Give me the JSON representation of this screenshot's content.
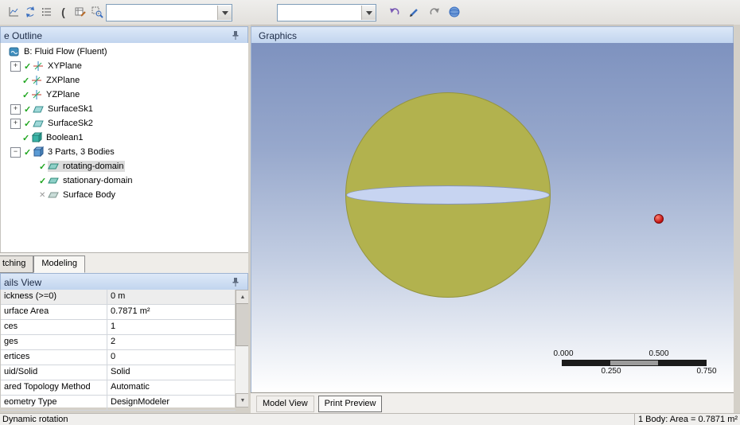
{
  "toolbar": {
    "combo1": {
      "value": ""
    },
    "combo2": {
      "value": ""
    }
  },
  "outline": {
    "title": "e Outline",
    "items": [
      {
        "label": "B: Fluid Flow (Fluent)"
      },
      {
        "label": "XYPlane"
      },
      {
        "label": "ZXPlane"
      },
      {
        "label": "YZPlane"
      },
      {
        "label": "SurfaceSk1"
      },
      {
        "label": "SurfaceSk2"
      },
      {
        "label": "Boolean1"
      },
      {
        "label": "3 Parts, 3 Bodies"
      },
      {
        "label": "rotating-domain"
      },
      {
        "label": "stationary-domain"
      },
      {
        "label": "Surface Body"
      }
    ],
    "tabs": {
      "sketching": "tching",
      "modeling": "Modeling"
    }
  },
  "details": {
    "title": "ails View",
    "rows": [
      {
        "label": "ickness (>=0)",
        "value": "0 m"
      },
      {
        "label": "urface Area",
        "value": "0.7871 m²"
      },
      {
        "label": "ces",
        "value": "1"
      },
      {
        "label": "ges",
        "value": "2"
      },
      {
        "label": "ertices",
        "value": "0"
      },
      {
        "label": "uid/Solid",
        "value": "Solid"
      },
      {
        "label": "ared Topology Method",
        "value": "Automatic"
      },
      {
        "label": "eometry Type",
        "value": "DesignModeler"
      }
    ]
  },
  "graphics": {
    "title": "Graphics",
    "ruler": {
      "top_labels": [
        "0.000",
        "0.500"
      ],
      "bottom_labels": [
        "0.250",
        "0.750"
      ]
    },
    "tabs": {
      "model_view": "Model View",
      "print_preview": "Print Preview"
    }
  },
  "status": {
    "left": "Dynamic rotation",
    "right": "1 Body: Area = 0.7871 m²"
  },
  "colors": {
    "sphere_body": "#b2b24e",
    "disk": "#c7d4f1",
    "point": "#cc1a1a",
    "header": "#c9dcf3"
  }
}
